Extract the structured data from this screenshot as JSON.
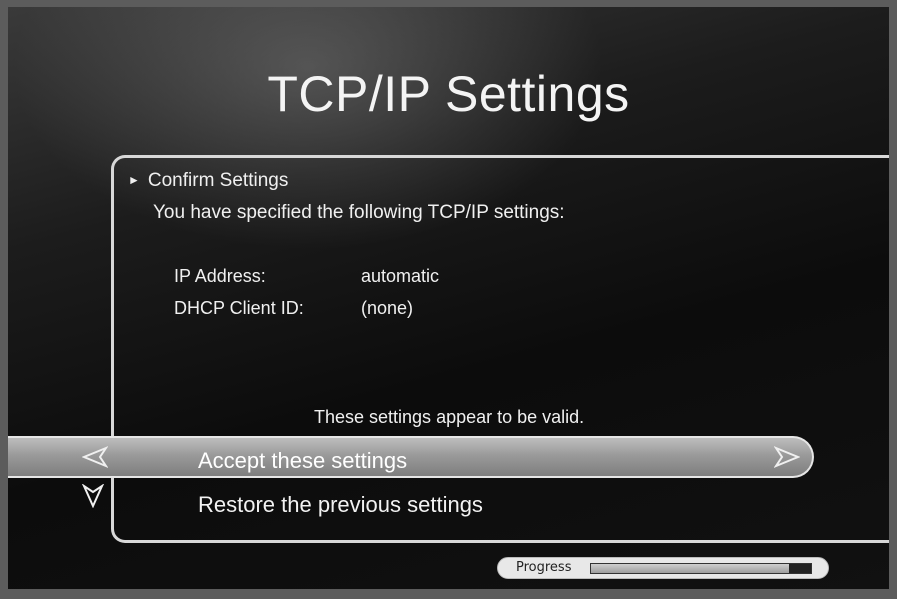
{
  "title": "TCP/IP Settings",
  "section": {
    "heading": "Confirm Settings",
    "intro": "You have specified the following TCP/IP settings:"
  },
  "settings": [
    {
      "label": "IP Address:",
      "value": "automatic"
    },
    {
      "label": "DHCP Client ID:",
      "value": "(none)"
    }
  ],
  "validation_message": "These settings appear to be valid.",
  "options": [
    {
      "label": "Accept these settings",
      "selected": true
    },
    {
      "label": "Restore the previous settings",
      "selected": false
    }
  ],
  "progress": {
    "label": "Progress",
    "fraction": 0.9
  },
  "icons": {
    "section_marker": "right-triangle-icon",
    "nav_left": "left-arrow-icon",
    "nav_right": "right-arrow-icon",
    "nav_down": "down-arrow-icon"
  }
}
